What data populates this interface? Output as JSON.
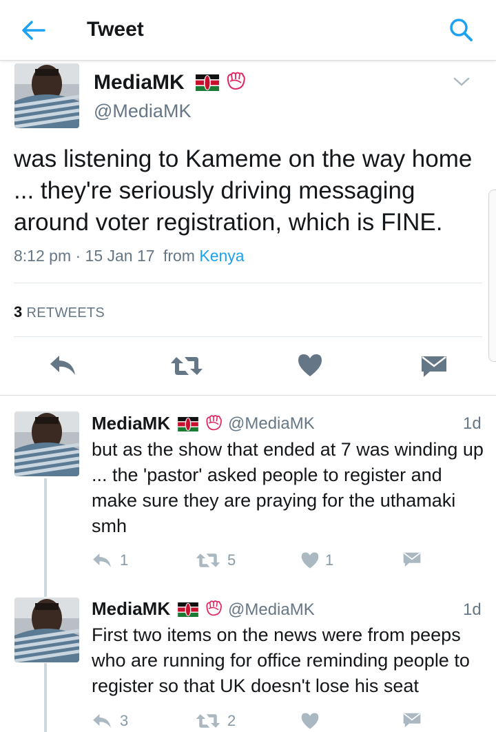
{
  "header": {
    "title": "Tweet",
    "back_icon": "arrow-left-icon",
    "search_icon": "search-icon"
  },
  "main_tweet": {
    "display_name": "MediaMK",
    "handle": "@MediaMK",
    "text": "was listening to Kameme on the way home ... they're seriously driving messaging around voter registration, which is FINE.",
    "time": "8:12 pm · 15 Jan 17",
    "from_label": "from",
    "location": "Kenya",
    "retweets_count": "3",
    "retweets_label": "RETWEETS"
  },
  "replies": [
    {
      "display_name": "MediaMK",
      "handle": "@MediaMK",
      "time": "1d",
      "text": "but as the show that ended at 7 was winding up ... the 'pastor' asked people to register and make sure they are praying for the uthamaki smh",
      "reply_count": "1",
      "retweet_count": "5",
      "like_count": "1"
    },
    {
      "display_name": "MediaMK",
      "handle": "@MediaMK",
      "time": "1d",
      "text": "First two items on the news were from peeps who are running for office reminding people to register so that UK doesn't lose his seat",
      "reply_count": "3",
      "retweet_count": "2",
      "like_count": ""
    }
  ],
  "colors": {
    "accent": "#1da1f2",
    "text": "#14171a",
    "muted": "#657786",
    "icon": "#657786",
    "divider": "#e1e8ed"
  }
}
